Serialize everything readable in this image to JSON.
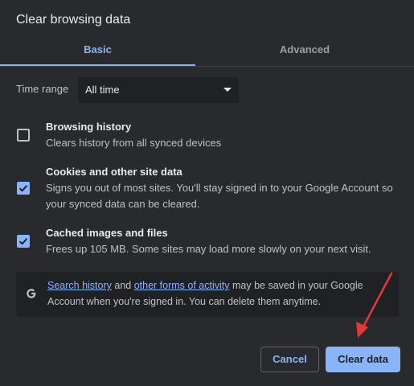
{
  "dialog": {
    "title": "Clear browsing data"
  },
  "tabs": [
    {
      "label": "Basic",
      "selected": true
    },
    {
      "label": "Advanced",
      "selected": false
    }
  ],
  "time_range": {
    "label": "Time range",
    "value": "All time"
  },
  "items": [
    {
      "title": "Browsing history",
      "desc": "Clears history from all synced devices",
      "checked": false
    },
    {
      "title": "Cookies and other site data",
      "desc": "Signs you out of most sites. You'll stay signed in to your Google Account so your synced data can be cleared.",
      "checked": true
    },
    {
      "title": "Cached images and files",
      "desc": "Frees up 105 MB. Some sites may load more slowly on your next visit.",
      "checked": true
    }
  ],
  "info": {
    "link1": "Search history",
    "and": " and ",
    "link2": "other forms of activity",
    "rest": " may be saved in your Google Account when you're signed in. You can delete them anytime."
  },
  "buttons": {
    "cancel": "Cancel",
    "clear": "Clear data"
  },
  "colors": {
    "accent": "#8ab4f8",
    "background": "#292a2d",
    "annotation_arrow": "#e53935"
  }
}
